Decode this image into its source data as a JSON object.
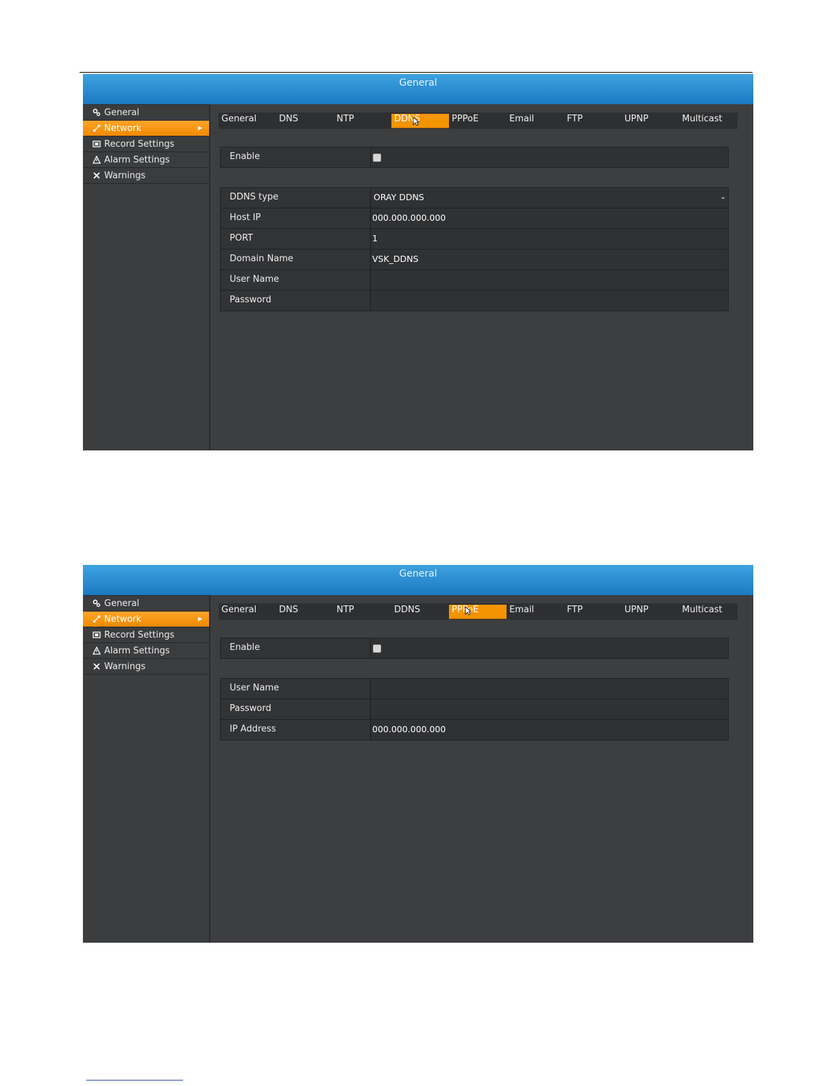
{
  "screens": [
    {
      "title": "General",
      "sidebar": [
        {
          "label": "General",
          "icon": "gears-icon"
        },
        {
          "label": "Network",
          "icon": "network-icon",
          "active": true
        },
        {
          "label": "Record Settings",
          "icon": "film-icon"
        },
        {
          "label": "Alarm Settings",
          "icon": "warning-icon"
        },
        {
          "label": "Warnings",
          "icon": "tools-icon"
        }
      ],
      "tabs": [
        "General",
        "DNS",
        "NTP",
        "DDNS",
        "PPPoE",
        "Email",
        "FTP",
        "UPNP",
        "Multicast"
      ],
      "active_tab": "DDNS",
      "enable": {
        "label": "Enable",
        "checked": false
      },
      "fields": [
        {
          "label": "DDNS type",
          "value": "ORAY DDNS",
          "dropdown": true
        },
        {
          "label": "Host IP",
          "value": "000.000.000.000"
        },
        {
          "label": "PORT",
          "value": "1"
        },
        {
          "label": "Domain Name",
          "value": "VSK_DDNS"
        },
        {
          "label": "User Name",
          "value": ""
        },
        {
          "label": "Password",
          "value": ""
        }
      ]
    },
    {
      "title": "General",
      "sidebar": [
        {
          "label": "General",
          "icon": "gears-icon"
        },
        {
          "label": "Network",
          "icon": "network-icon",
          "active": true
        },
        {
          "label": "Record Settings",
          "icon": "film-icon"
        },
        {
          "label": "Alarm Settings",
          "icon": "warning-icon"
        },
        {
          "label": "Warnings",
          "icon": "tools-icon"
        }
      ],
      "tabs": [
        "General",
        "DNS",
        "NTP",
        "DDNS",
        "PPPoE",
        "Email",
        "FTP",
        "UPNP",
        "Multicast"
      ],
      "active_tab": "PPPoE",
      "enable": {
        "label": "Enable",
        "checked": false
      },
      "fields": [
        {
          "label": "User Name",
          "value": ""
        },
        {
          "label": "Password",
          "value": ""
        },
        {
          "label": "IP Address",
          "value": "000.000.000.000"
        }
      ]
    }
  ],
  "colors": {
    "accent": "#f39400",
    "titlebar": "#2b8dd2",
    "panel": "#3d3e40"
  }
}
